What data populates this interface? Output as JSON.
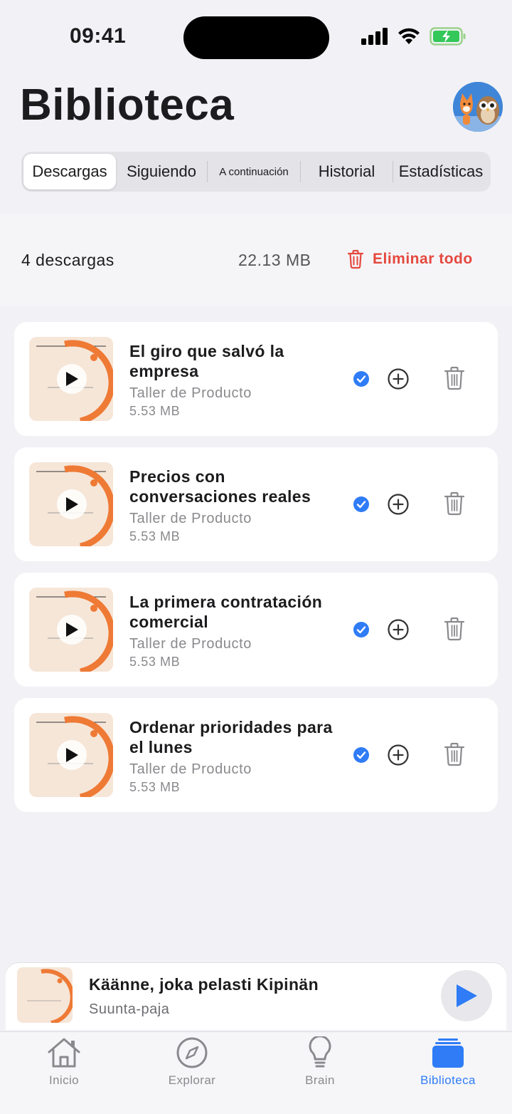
{
  "status_bar": {
    "time": "09:41"
  },
  "header": {
    "title": "Biblioteca"
  },
  "tabs": [
    {
      "label": "Descargas",
      "active": true
    },
    {
      "label": "Siguiendo",
      "active": false
    },
    {
      "label": "A continuación",
      "active": false
    },
    {
      "label": "Historial",
      "active": false
    },
    {
      "label": "Estadísticas",
      "active": false
    }
  ],
  "summary": {
    "count": "4 descargas",
    "total_size": "22.13 MB",
    "delete_all_label": "Eliminar todo"
  },
  "downloads": [
    {
      "title": "El giro que salvó la empresa",
      "show": "Taller de Producto",
      "size": "5.53 MB",
      "thumb_text": "TALLER DE PRODUCTO",
      "downloaded": true
    },
    {
      "title": "Precios con conversaciones reales",
      "show": "Taller de Producto",
      "size": "5.53 MB",
      "thumb_text": "TALLER DE PRODUCTO",
      "downloaded": true
    },
    {
      "title": "La primera contratación comercial",
      "show": "Taller de Producto",
      "size": "5.53 MB",
      "thumb_text": "TALLER DE PRODUCTO",
      "downloaded": true
    },
    {
      "title": "Ordenar prioridades para el lunes",
      "show": "Taller de Producto",
      "size": "5.53 MB",
      "thumb_text": "TALLER DE PRODUCTO",
      "downloaded": true
    }
  ],
  "mini_player": {
    "title": "Käänne, joka pelasti Kipinän",
    "subtitle": "Suunta-paja",
    "thumb_text": "SUUNTA-PAJA"
  },
  "tab_bar": [
    {
      "label": "Inicio",
      "icon": "home-icon",
      "active": false
    },
    {
      "label": "Explorar",
      "icon": "compass-icon",
      "active": false
    },
    {
      "label": "Brain",
      "icon": "lightbulb-icon",
      "active": false
    },
    {
      "label": "Biblioteca",
      "icon": "library-icon",
      "active": true
    }
  ],
  "colors": {
    "accent": "#2f7cf6",
    "destructive": "#e5483d",
    "thumb_orange": "#ee7a35",
    "background": "#f2f2f6"
  }
}
